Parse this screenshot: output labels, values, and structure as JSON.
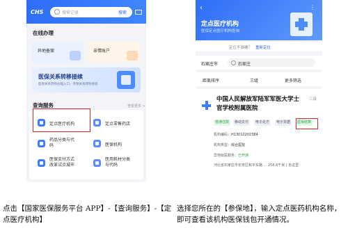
{
  "left_phone": {
    "logo": "CHS",
    "search_placeholder": "搜索记录",
    "search_button": "搜索",
    "online_section": "在线办理",
    "tiles": [
      "异地备案",
      "亲情账户"
    ],
    "banner_title": "医保关系转移接续",
    "banner_sub": "医保关系转移办理入口，参保关系转移接续",
    "query_section": "查询服务",
    "more": "查看更多 >",
    "services": [
      "定点医疗机构",
      "定点零售药店",
      "药品分类与代码",
      "医保机构",
      "医保支付方式改革试点城市",
      "医用耗材分类与代码"
    ]
  },
  "right_phone": {
    "title": "定点医疗机构",
    "subtitle": "医保定点医疗机构查询",
    "loc_question": "定位不准确？",
    "loc_action": "重新定位",
    "city": "石家庄市",
    "search_text": "石家庄",
    "filters": [
      "距离排序",
      "三级",
      "更多筛选"
    ],
    "hospital_name": "中国人民解放军陆军军医大学士官学校附属医院",
    "grade": "三级",
    "tags": [
      "普通住院",
      "移动支付",
      "电子处方",
      "电子票据",
      "医保结算"
    ],
    "info": [
      {
        "label": "机构编码：",
        "value": "H13012202384"
      },
      {
        "label": "机构类型：",
        "value": "综合医院"
      },
      {
        "label": "异地就医服务：",
        "value": "已开通"
      }
    ],
    "address": "河北省石家庄市长安区和平东路 ... 258.6千米 | 去这里"
  },
  "captions": {
    "left": "点击【国家医保服务平台 APP】-【查询服务】-【定点医疗机构】",
    "right": "选择您所在的【参保地】，输入定点医药机构名称，即可查看该机构医保钱包开通情况。"
  }
}
